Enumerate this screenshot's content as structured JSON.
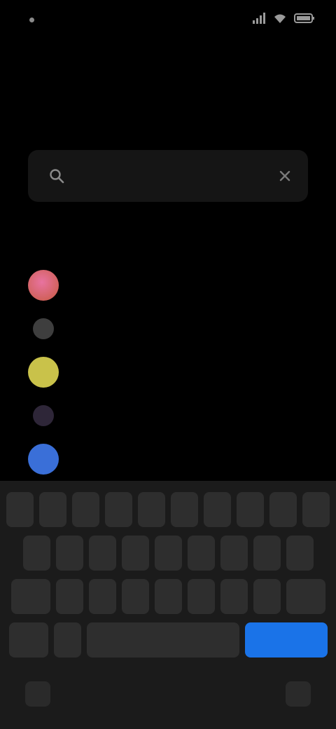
{
  "status_bar": {
    "time": "",
    "icons": [
      "signal-icon",
      "wifi-icon",
      "battery-icon"
    ]
  },
  "header": {
    "handle": "",
    "title": ""
  },
  "search": {
    "placeholder": "",
    "value": ""
  },
  "results": [
    {
      "label": "",
      "icon": "app-icon",
      "color": "#d8607a"
    },
    {
      "label": "",
      "icon": "app-icon",
      "color": "#4a4a4a"
    },
    {
      "label": "",
      "icon": "app-icon",
      "color": "#c9c24a"
    },
    {
      "label": "",
      "icon": "app-icon",
      "color": "#3a3040"
    },
    {
      "label": "",
      "icon": "app-icon",
      "color": "#3a6fd8"
    }
  ],
  "colors": {
    "background": "#000000",
    "search_bg": "#151515",
    "keyboard_bg": "#1b1b1b",
    "key_bg": "#2e2e2e",
    "accent": "#1a73e8"
  }
}
